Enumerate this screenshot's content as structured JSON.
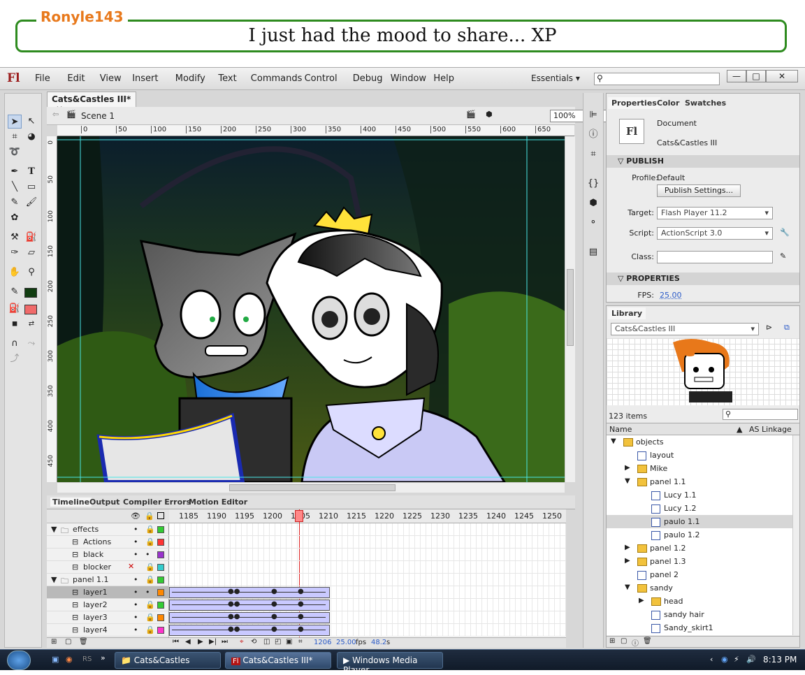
{
  "banner": {
    "username": "Ronyle143",
    "message": "I just had the mood to share... XP"
  },
  "app": {
    "logo": "Fl",
    "menus": [
      "File",
      "Edit",
      "View",
      "Insert",
      "Modify",
      "Text",
      "Commands",
      "Control",
      "Debug",
      "Window",
      "Help"
    ],
    "workspace": "Essentials",
    "document_tab": "Cats&Castles III*",
    "scene": "Scene 1",
    "zoom": "100%",
    "ruler_top": [
      "0",
      "50",
      "100",
      "150",
      "200",
      "250",
      "300",
      "350",
      "400",
      "450",
      "500",
      "550",
      "600",
      "650"
    ],
    "ruler_left": [
      "0",
      "50",
      "100",
      "150",
      "200",
      "250",
      "300",
      "350",
      "400",
      "450"
    ]
  },
  "timeline": {
    "tabs": [
      "Timeline",
      "Output",
      "Compiler Errors",
      "Motion Editor"
    ],
    "frame_numbers": [
      "1185",
      "1190",
      "1195",
      "1200",
      "1205",
      "1210",
      "1215",
      "1220",
      "1225",
      "1230",
      "1235",
      "1240",
      "1245",
      "1250"
    ],
    "current_frame": "1206",
    "fps": "25.00",
    "fps_unit": "fps",
    "time": "48.2",
    "time_unit": "s",
    "layers": [
      {
        "name": "effects",
        "type": "folder",
        "color": "#33cc33"
      },
      {
        "name": "Actions",
        "type": "layer",
        "color": "#ff3333"
      },
      {
        "name": "black",
        "type": "layer",
        "color": "#9933cc"
      },
      {
        "name": "blocker",
        "type": "layer",
        "color": "#33cccc"
      },
      {
        "name": "panel 1.1",
        "type": "folder",
        "color": "#33cc33"
      },
      {
        "name": "layer1",
        "type": "layer",
        "color": "#ff8800",
        "selected": true
      },
      {
        "name": "layer2",
        "type": "layer",
        "color": "#33cc33"
      },
      {
        "name": "layer3",
        "type": "layer",
        "color": "#ff8800"
      },
      {
        "name": "layer4",
        "type": "layer",
        "color": "#ff33cc"
      }
    ]
  },
  "properties": {
    "tabs": [
      "Properties",
      "Color",
      "Swatches"
    ],
    "doc_type": "Document",
    "doc_name": "Cats&Castles III",
    "publish_header": "PUBLISH",
    "profile_label": "Profile:",
    "profile_value": "Default",
    "publish_settings": "Publish Settings...",
    "target_label": "Target:",
    "target_value": "Flash Player 11.2",
    "script_label": "Script:",
    "script_value": "ActionScript 3.0",
    "class_label": "Class:",
    "class_value": "",
    "properties_header": "PROPERTIES",
    "fps_label": "FPS:",
    "fps_value": "25.00"
  },
  "library": {
    "title": "Library",
    "doc": "Cats&Castles III",
    "count": "123 items",
    "col_name": "Name",
    "col_linkage": "AS Linkage",
    "items": [
      {
        "name": "objects",
        "type": "folder-open",
        "indent": 0
      },
      {
        "name": "layout",
        "type": "symbol",
        "indent": 1
      },
      {
        "name": "Mike",
        "type": "folder",
        "indent": 1
      },
      {
        "name": "panel 1.1",
        "type": "folder-open",
        "indent": 1
      },
      {
        "name": "Lucy 1.1",
        "type": "symbol",
        "indent": 2
      },
      {
        "name": "Lucy 1.2",
        "type": "symbol",
        "indent": 2
      },
      {
        "name": "paulo 1.1",
        "type": "symbol",
        "indent": 2,
        "selected": true
      },
      {
        "name": "paulo 1.2",
        "type": "symbol",
        "indent": 2
      },
      {
        "name": "panel 1.2",
        "type": "folder",
        "indent": 1
      },
      {
        "name": "panel 1.3",
        "type": "folder",
        "indent": 1
      },
      {
        "name": "panel 2",
        "type": "symbol",
        "indent": 1
      },
      {
        "name": "sandy",
        "type": "folder-open",
        "indent": 1
      },
      {
        "name": "head",
        "type": "folder",
        "indent": 2
      },
      {
        "name": "sandy hair",
        "type": "symbol",
        "indent": 2
      },
      {
        "name": "Sandy_skirt1",
        "type": "symbol",
        "indent": 2
      }
    ]
  },
  "taskbar": {
    "items": [
      "Cats&Castles",
      "Cats&Castles III*",
      "Windows Media Player"
    ],
    "clock": "8:13 PM"
  }
}
